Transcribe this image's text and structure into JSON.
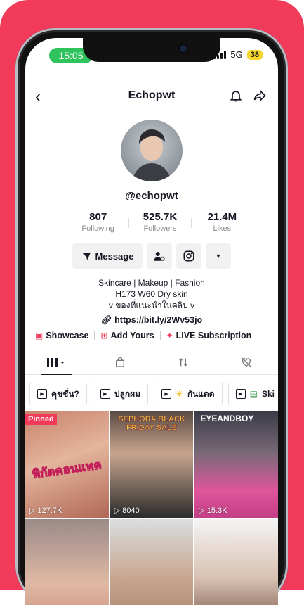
{
  "status": {
    "time": "15:05",
    "network": "5G",
    "battery": "38"
  },
  "header": {
    "title": "Echopwt"
  },
  "profile": {
    "handle": "@echopwt",
    "stats": [
      {
        "value": "807",
        "label": "Following"
      },
      {
        "value": "525.7K",
        "label": "Followers"
      },
      {
        "value": "21.4M",
        "label": "Likes"
      }
    ],
    "message_label": "Message",
    "bio": [
      "Skincare | Makeup | Fashion",
      "H173 W60 Dry skin",
      "v ของที่แนะนำในคลิป v"
    ],
    "link": "https://bit.ly/2Wv53jo",
    "features": [
      "Showcase",
      "Add Yours",
      "LIVE Subscription"
    ]
  },
  "playlists": [
    {
      "label": "คุชชั่น?"
    },
    {
      "label": "ปลูกผม"
    },
    {
      "label": "กันแดด"
    },
    {
      "label": "Ski"
    }
  ],
  "videos": [
    {
      "views": "127.7K",
      "pinned": "Pinned",
      "overlay": "พิกัดคอนแทค"
    },
    {
      "views": "8040",
      "overlay": "SEPHORA BLACK FRIDAY SALE"
    },
    {
      "views": "15.3K",
      "overlay": "EYEANDBOY"
    },
    {
      "views": "",
      "overlay": ""
    },
    {
      "views": "",
      "overlay": ""
    },
    {
      "views": "",
      "overlay": ""
    }
  ],
  "colors": {
    "accent": "#f23a5a",
    "status_green": "#2ec35c",
    "battery": "#f3d52b"
  }
}
